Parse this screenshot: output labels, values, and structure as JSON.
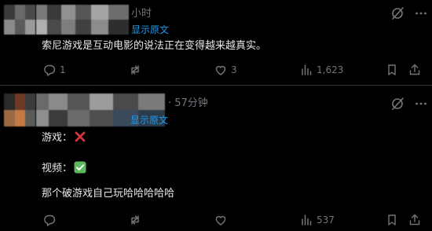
{
  "posts": [
    {
      "time": "小时",
      "show_original": "显示原文",
      "text": "索尼游戏是互动电影的说法正在变得越来越真实。",
      "actions": {
        "replies": "1",
        "reposts": "",
        "likes": "3",
        "views": "1,623"
      }
    },
    {
      "time": "· 57分钟",
      "show_original": "显示原文",
      "lines": [
        "游戏：",
        "视频：",
        "那个破游戏自己玩哈哈哈哈哈"
      ],
      "actions": {
        "replies": "",
        "reposts": "",
        "likes": "",
        "views": "537"
      }
    }
  ],
  "icons": {
    "grok": "grok-icon",
    "more": "more-icon",
    "reply": "reply-icon",
    "repost": "repost-icon",
    "like": "like-icon",
    "views": "views-icon",
    "bookmark": "bookmark-icon",
    "share": "share-icon",
    "cross": "cross-mark-emoji",
    "check": "check-mark-emoji"
  },
  "colors": {
    "background": "#000000",
    "text": "#e7e9ea",
    "muted": "#71767b",
    "link": "#1d9bf0",
    "divider": "#2f3336",
    "cross": "#d0343e",
    "check": "#5cb85c"
  }
}
